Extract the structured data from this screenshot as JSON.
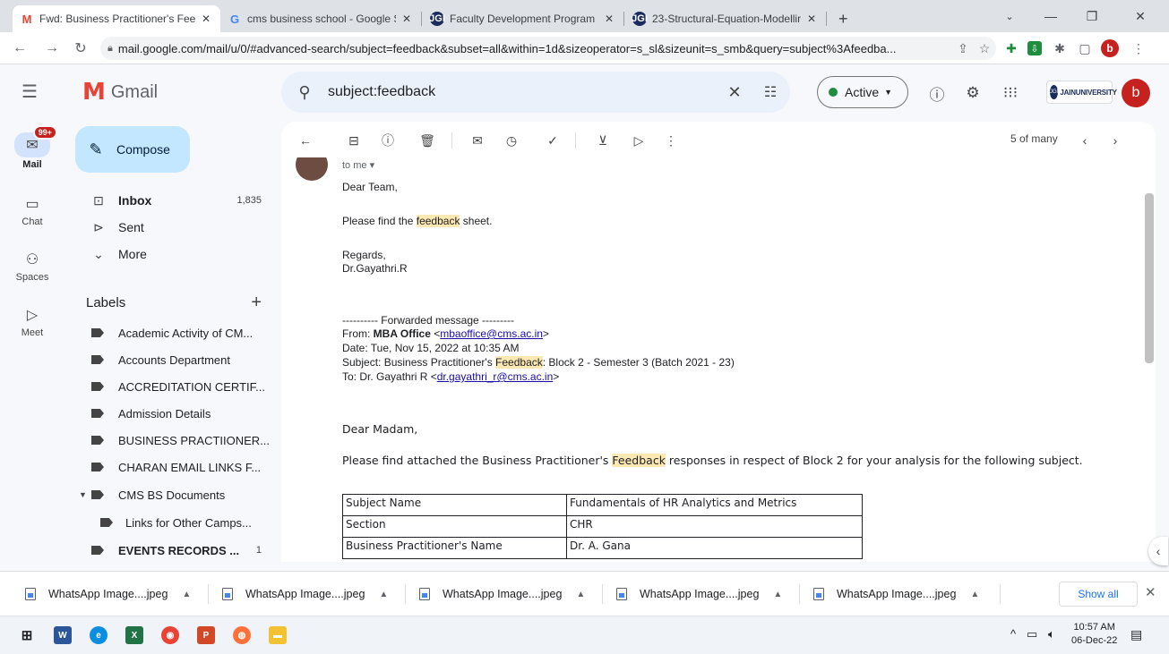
{
  "browser": {
    "tabs": [
      {
        "label": "Fwd: Business Practitioner's Feed",
        "icon": "gmail-icon",
        "active": true
      },
      {
        "label": "cms business school - Google Se",
        "icon": "google-icon",
        "active": false
      },
      {
        "label": "Faculty Development Program",
        "icon": "jgi-icon",
        "active": false
      },
      {
        "label": "23-Structural-Equation-Modelling",
        "icon": "jgi-icon",
        "active": false
      }
    ],
    "new_tab": "+",
    "url": "mail.google.com/mail/u/0/#advanced-search/subject=feedback&subset=all&within=1d&sizeoperator=s_sl&sizeunit=s_smb&query=subject%3Afeedba...",
    "profile_initial": "b"
  },
  "gmail": {
    "wordmark": "Gmail",
    "search_query": "subject:feedback",
    "status": "Active",
    "org_logo_text": "JAINUNIVERSITY",
    "avatar_initial": "b",
    "rail": [
      {
        "label": "Mail",
        "badge": "99+"
      },
      {
        "label": "Chat"
      },
      {
        "label": "Spaces"
      },
      {
        "label": "Meet"
      }
    ],
    "compose_label": "Compose",
    "nav": [
      {
        "label": "Inbox",
        "count": "1,835"
      },
      {
        "label": "Sent",
        "count": ""
      },
      {
        "label": "More",
        "count": ""
      }
    ],
    "labels_heading": "Labels",
    "labels": [
      {
        "label": "Academic Activity of CM...",
        "count": ""
      },
      {
        "label": "Accounts Department",
        "count": ""
      },
      {
        "label": "ACCREDITATION CERTIF...",
        "count": ""
      },
      {
        "label": "Admission Details",
        "count": ""
      },
      {
        "label": "BUSINESS PRACTIIONER...",
        "count": ""
      },
      {
        "label": "CHARAN EMAIL LINKS F...",
        "count": ""
      },
      {
        "label": "CMS BS Documents",
        "count": ""
      },
      {
        "label": "Links for Other Camps...",
        "count": ""
      },
      {
        "label": "EVENTS RECORDS ...",
        "count": "1"
      }
    ],
    "pager": "5 of many"
  },
  "email": {
    "to_me": "to me ▾",
    "greeting": "Dear Team,",
    "line1_pre": "Please find the ",
    "line1_hl": "feedback",
    "line1_post": " sheet.",
    "regards": "Regards,",
    "signature": "Dr.Gayathri.R",
    "fwd_header": "---------- Forwarded message ---------",
    "from_label": "From: ",
    "from_name": "MBA Office",
    "from_email": "mbaoffice@cms.ac.in",
    "date_line": "Date: Tue, Nov 15, 2022 at 10:35 AM",
    "subject_pre": "Subject: Business Practitioner's ",
    "subject_hl": "Feedback",
    "subject_post": ": Block 2 - Semester 3 (Batch 2021 - 23)",
    "to_pre": "To: Dr. Gayathri R <",
    "to_email": "dr.gayathri_r@cms.ac.in",
    "madam": "Dear Madam,",
    "body_pre": "Please find attached the Business Practitioner's ",
    "body_hl": "Feedback",
    "body_post": " responses in respect of Block 2 for your analysis for the following subject.",
    "table": [
      {
        "key": "Subject Name",
        "value": "Fundamentals of HR Analytics and Metrics"
      },
      {
        "key": "Section",
        "value": "CHR"
      },
      {
        "key": "Business Practitioner's Name",
        "value": "Dr. A. Gana"
      }
    ]
  },
  "downloads": {
    "items": [
      "WhatsApp Image....jpeg",
      "WhatsApp Image....jpeg",
      "WhatsApp Image....jpeg",
      "WhatsApp Image....jpeg",
      "WhatsApp Image....jpeg"
    ],
    "show_all": "Show all"
  },
  "taskbar": {
    "time": "10:57 AM",
    "date": "06-Dec-22"
  },
  "colors": {
    "accent": "#c2e7ff",
    "highlight": "#fce8b2",
    "brand_red": "#ea4335",
    "active_green": "#1e8e3e"
  }
}
